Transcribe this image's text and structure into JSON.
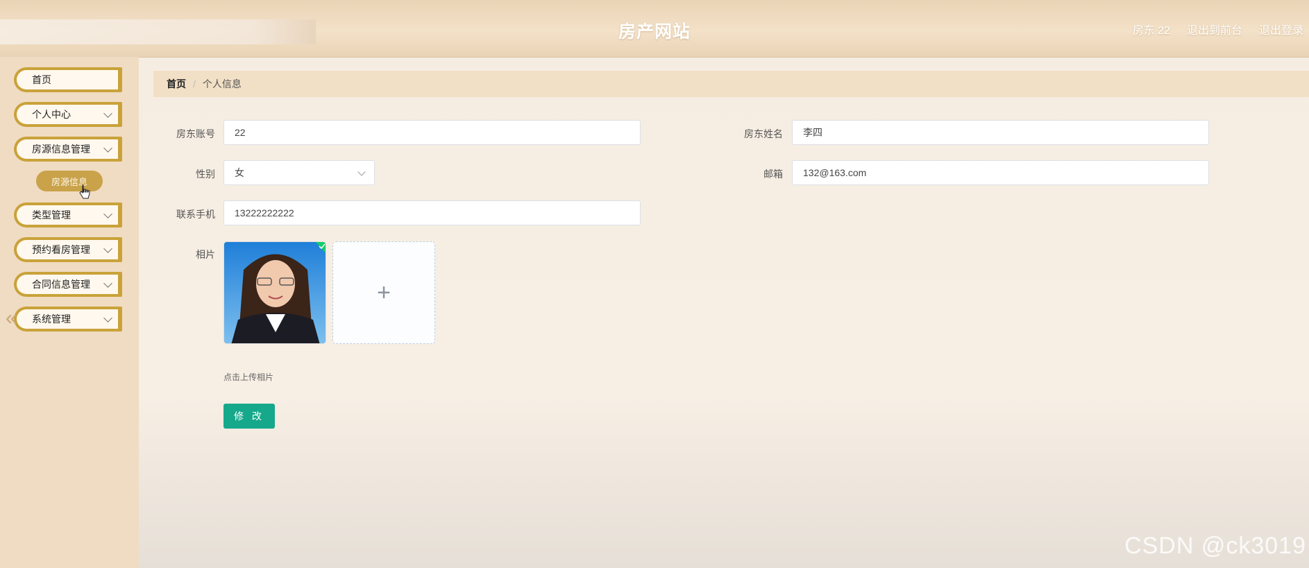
{
  "header": {
    "title": "房产网站",
    "user": "房东 22",
    "exit_front": "退出到前台",
    "logout": "退出登录"
  },
  "sidebar": {
    "items": [
      {
        "label": "首页",
        "has_submenu": false
      },
      {
        "label": "个人中心",
        "has_submenu": true
      },
      {
        "label": "房源信息管理",
        "has_submenu": true
      },
      {
        "label": "类型管理",
        "has_submenu": true
      },
      {
        "label": "预约看房管理",
        "has_submenu": true
      },
      {
        "label": "合同信息管理",
        "has_submenu": true
      },
      {
        "label": "系统管理",
        "has_submenu": true
      }
    ],
    "submenu_label": "房源信息"
  },
  "breadcrumb": {
    "home": "首页",
    "separator": "/",
    "current": "个人信息"
  },
  "form": {
    "account_label": "房东账号",
    "account_value": "22",
    "name_label": "房东姓名",
    "name_value": "李四",
    "gender_label": "性别",
    "gender_value": "女",
    "email_label": "邮箱",
    "email_value": "132@163.com",
    "phone_label": "联系手机",
    "phone_value": "13222222222",
    "photo_label": "相片",
    "upload_tip": "点击上传相片",
    "submit_label": "修 改"
  },
  "watermark": "CSDN @ck3019",
  "colors": {
    "accent": "#c9a23a",
    "button": "#16a88b",
    "breadcrumb_bg": "#f1dfc6"
  }
}
